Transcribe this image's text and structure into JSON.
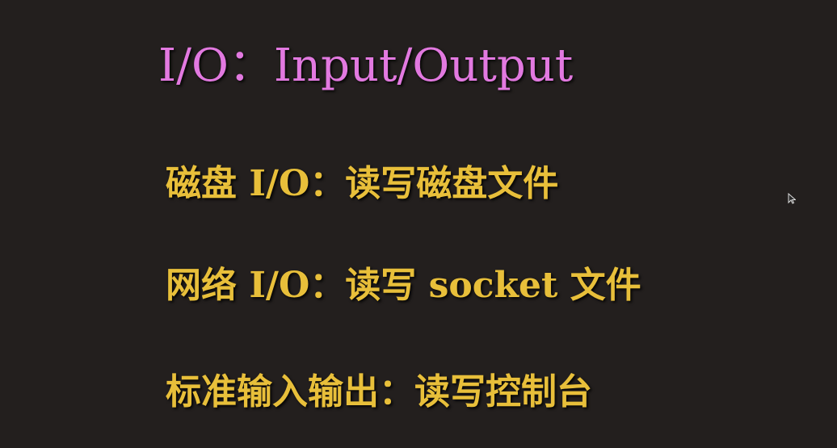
{
  "slide": {
    "title": "I/O：Input/Output",
    "lines": [
      "磁盘 I/O：读写磁盘文件",
      "网络 I/O：读写 socket 文件",
      "标准输入输出：读写控制台"
    ]
  },
  "colors": {
    "background": "#231f1e",
    "title": "#e279e0",
    "body_text": "#e8bf3a"
  },
  "icons": {
    "pointer": "mouse-pointer-icon"
  }
}
